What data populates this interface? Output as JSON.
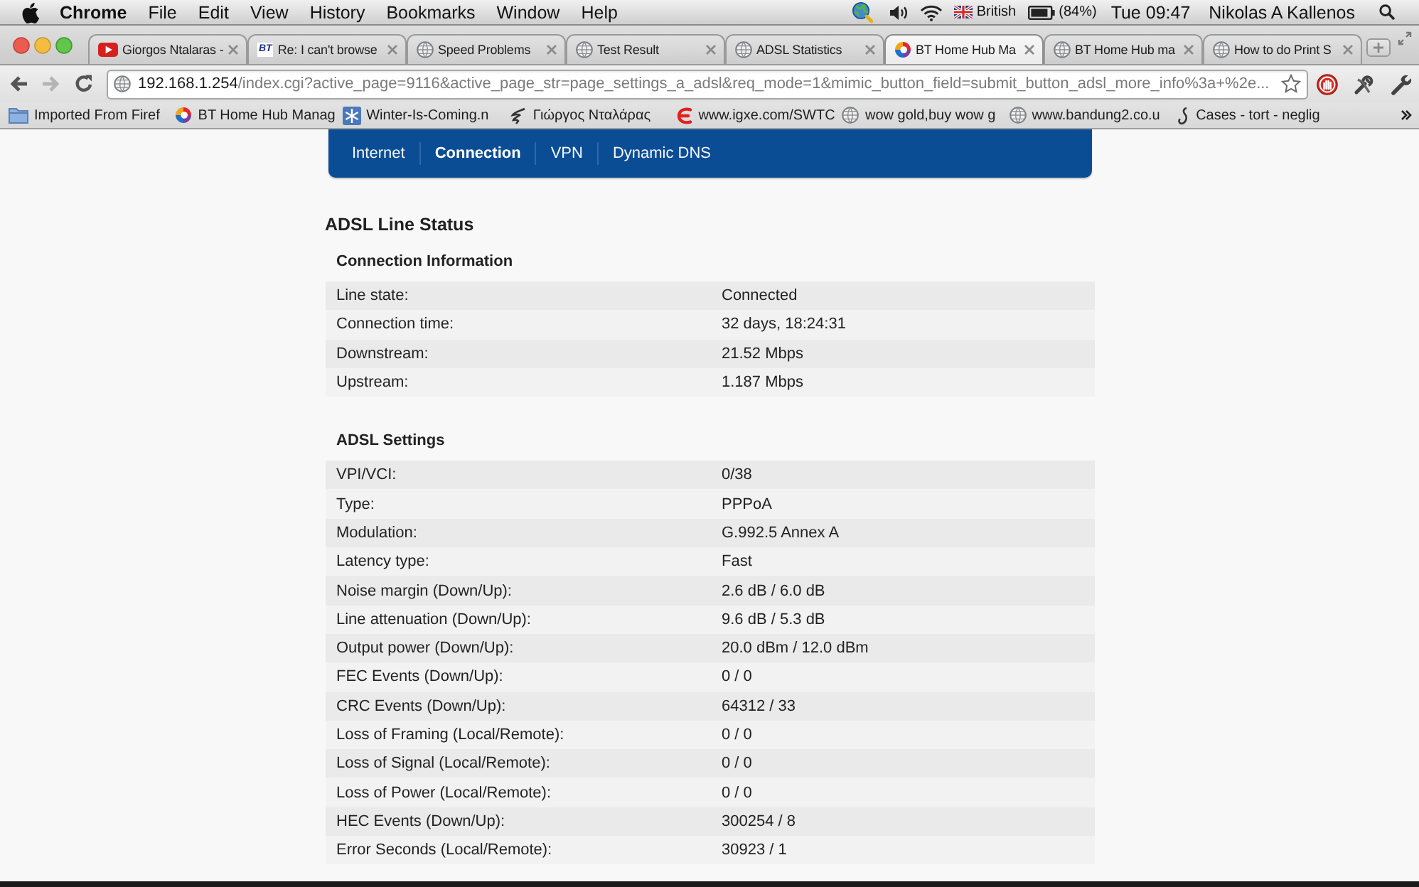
{
  "menu_bar": {
    "app_name": "Chrome",
    "menus": [
      "File",
      "Edit",
      "View",
      "History",
      "Bookmarks",
      "Window",
      "Help"
    ],
    "input_source": "British",
    "battery": "(84%)",
    "clock": "Tue 09:47",
    "user": "Nikolas A Kallenos"
  },
  "tabs": [
    {
      "title": "Giorgos Ntalaras -",
      "kind": "play",
      "selected": false
    },
    {
      "title": "Re: I can't browse",
      "kind": "letters",
      "favicon_text": "BT",
      "selected": false
    },
    {
      "title": "Speed Problems",
      "kind": "globe",
      "selected": false
    },
    {
      "title": "Test Result",
      "kind": "globe",
      "selected": false
    },
    {
      "title": "ADSL Statistics",
      "kind": "globe",
      "selected": false
    },
    {
      "title": "BT Home Hub Ma",
      "kind": "swirl",
      "selected": true
    },
    {
      "title": "BT Home Hub ma",
      "kind": "globe",
      "selected": false
    },
    {
      "title": "How to do Print S",
      "kind": "globe",
      "selected": false
    }
  ],
  "toolbar": {
    "buttons": [
      {
        "kind": "back",
        "disabled": false
      },
      {
        "kind": "forward",
        "disabled": true
      },
      {
        "kind": "reload",
        "disabled": false
      }
    ],
    "url_host": "192.168.1.254",
    "url_path": "/index.cgi?active_page=9116&active_page_str=page_settings_a_adsl&req_mode=1&mimic_button_field=submit_button_adsl_more_info%3a+%2e...",
    "bookmarked": false
  },
  "bookmarks": [
    {
      "label": "Imported From Firef",
      "kind": "folder"
    },
    {
      "label": "BT Home Hub Manag",
      "kind": "swirl"
    },
    {
      "label": "Winter-Is-Coming.n",
      "kind": "snowflake"
    },
    {
      "label": "Γιώργος Νταλάρας",
      "kind": "scribble"
    },
    {
      "label": "www.igxe.com/SWTC",
      "kind": "logo"
    },
    {
      "label": "wow gold,buy wow g",
      "kind": "globe"
    },
    {
      "label": "www.bandung2.co.u",
      "kind": "globe"
    },
    {
      "label": "Cases - tort - neglig",
      "kind": "curl"
    }
  ],
  "router_nav": [
    {
      "label": "Internet",
      "selected": false
    },
    {
      "label": "Connection",
      "selected": true
    },
    {
      "label": "VPN",
      "selected": false
    },
    {
      "label": "Dynamic DNS",
      "selected": false
    }
  ],
  "status_page": {
    "title": "ADSL Line Status",
    "sections": [
      {
        "title": "Connection Information",
        "rows": [
          {
            "label": "Line state:",
            "value": "Connected"
          },
          {
            "label": "Connection time:",
            "value": "32 days, 18:24:31"
          },
          {
            "label": "Downstream:",
            "value": "21.52 Mbps"
          },
          {
            "label": "Upstream:",
            "value": "1.187 Mbps"
          }
        ]
      },
      {
        "title": "ADSL Settings",
        "rows": [
          {
            "label": "VPI/VCI:",
            "value": "0/38"
          },
          {
            "label": "Type:",
            "value": "PPPoA"
          },
          {
            "label": "Modulation:",
            "value": "G.992.5 Annex A"
          },
          {
            "label": "Latency type:",
            "value": "Fast"
          },
          {
            "label": "Noise margin (Down/Up):",
            "value": "2.6 dB / 6.0 dB"
          },
          {
            "label": "Line attenuation (Down/Up):",
            "value": "9.6 dB / 5.3 dB"
          },
          {
            "label": "Output power (Down/Up):",
            "value": "20.0 dBm / 12.0 dBm"
          },
          {
            "label": "FEC Events (Down/Up):",
            "value": "0 / 0"
          },
          {
            "label": "CRC Events (Down/Up):",
            "value": "64312 / 33"
          },
          {
            "label": "Loss of Framing (Local/Remote):",
            "value": "0 / 0"
          },
          {
            "label": "Loss of Signal (Local/Remote):",
            "value": "0 / 0"
          },
          {
            "label": "Loss of Power (Local/Remote):",
            "value": "0 / 0"
          },
          {
            "label": "HEC Events (Down/Up):",
            "value": "300254 / 8"
          },
          {
            "label": "Error Seconds (Local/Remote):",
            "value": "30923 / 1"
          }
        ]
      }
    ]
  }
}
